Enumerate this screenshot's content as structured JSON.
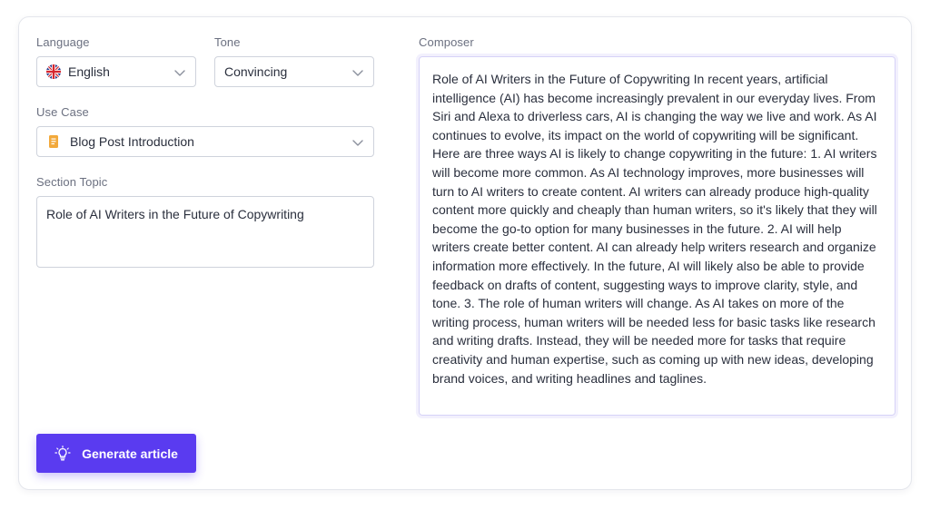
{
  "form": {
    "language": {
      "label": "Language",
      "value": "English",
      "icon": "uk-flag-icon"
    },
    "tone": {
      "label": "Tone",
      "value": "Convincing"
    },
    "use_case": {
      "label": "Use Case",
      "value": "Blog Post Introduction",
      "icon": "document-icon"
    },
    "section_topic": {
      "label": "Section Topic",
      "value": "Role of AI Writers in the Future of Copywriting"
    }
  },
  "composer": {
    "label": "Composer",
    "text": "Role of AI Writers in the Future of Copywriting In recent years, artificial intelligence (AI) has become increasingly prevalent in our everyday lives. From Siri and Alexa to driverless cars, AI is changing the way we live and work. As AI continues to evolve, its impact on the world of copywriting will be significant. Here are three ways AI is likely to change copywriting in the future: 1. AI writers will become more common. As AI technology improves, more businesses will turn to AI writers to create content. AI writers can already produce high-quality content more quickly and cheaply than human writers, so it's likely that they will become the go-to option for many businesses in the future. 2. AI will help writers create better content. AI can already help writers research and organize information more effectively. In the future, AI will likely also be able to provide feedback on drafts of content, suggesting ways to improve clarity, style, and tone. 3. The role of human writers will change. As AI takes on more of the writing process, human writers will be needed less for basic tasks like research and writing drafts. Instead, they will be needed more for tasks that require creativity and human expertise, such as coming up with new ideas, developing brand voices, and writing headlines and taglines."
  },
  "actions": {
    "generate_label": "Generate article",
    "generate_icon": "lightbulb-icon"
  },
  "colors": {
    "accent": "#5a3bf0",
    "border": "#cfd3dc",
    "label": "#6b7080",
    "text": "#2a2f3d"
  }
}
